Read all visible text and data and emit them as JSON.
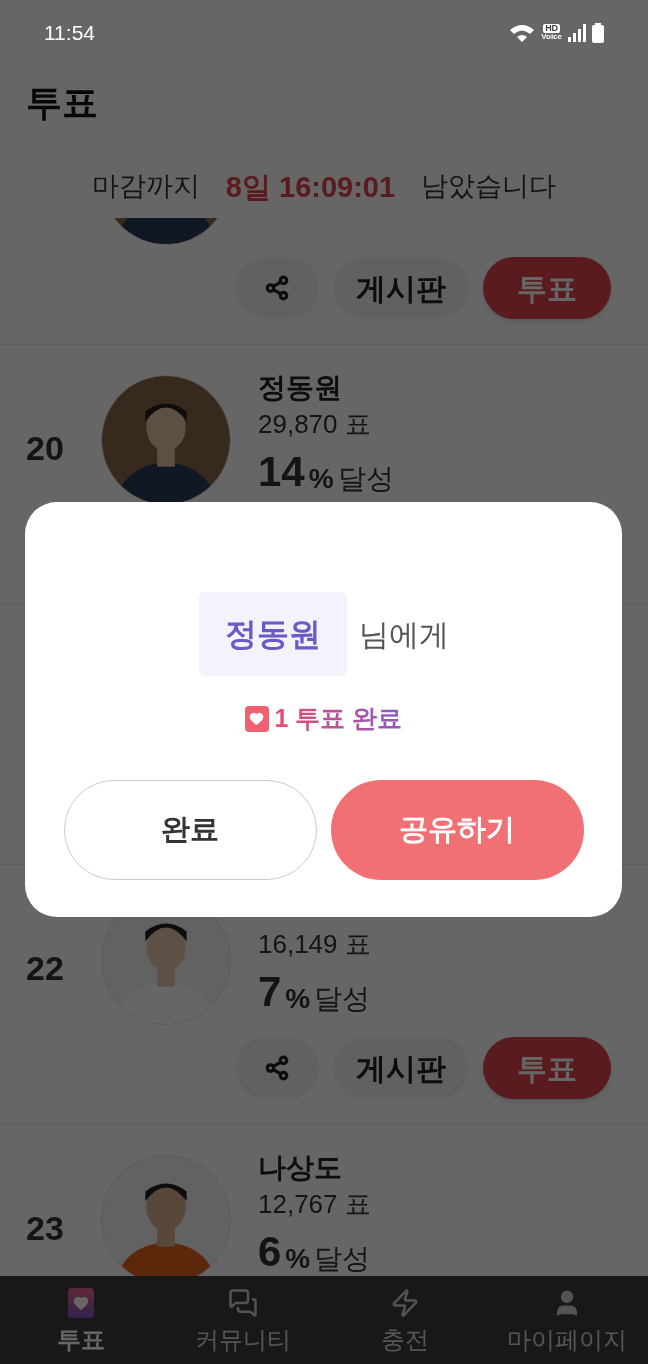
{
  "status_bar": {
    "time": "11:54",
    "hd_label": "HD",
    "voice_label": "Voice"
  },
  "header": {
    "title": "투표"
  },
  "countdown": {
    "prefix": "마감까지",
    "time": "8일 16:09:01",
    "suffix": "남았습니다"
  },
  "candidates": [
    {
      "board_label": "게시판",
      "vote_label": "투표"
    },
    {
      "rank": "20",
      "name": "정동원",
      "votes": "29,870 표",
      "percent": "14",
      "percent_sign": "%",
      "achieve": "달성"
    },
    {
      "rank": "22",
      "votes": "16,149 표",
      "percent": "7",
      "percent_sign": "%",
      "achieve": "달성",
      "board_label": "게시판",
      "vote_label": "투표"
    },
    {
      "rank": "23",
      "name": "나상도",
      "votes": "12,767 표",
      "percent": "6",
      "percent_sign": "%",
      "achieve": "달성"
    }
  ],
  "modal": {
    "recipient": "정동원",
    "recipient_suffix": "님에게",
    "result": "1 투표 완료",
    "buttons": [
      {
        "label": "완료",
        "kind": "outline"
      },
      {
        "label": "공유하기",
        "kind": "primary"
      }
    ]
  },
  "nav": [
    {
      "label": "투표",
      "selected": true
    },
    {
      "label": "커뮤니티",
      "selected": false
    },
    {
      "label": "충전",
      "selected": false
    },
    {
      "label": "마이페이지",
      "selected": false
    }
  ]
}
